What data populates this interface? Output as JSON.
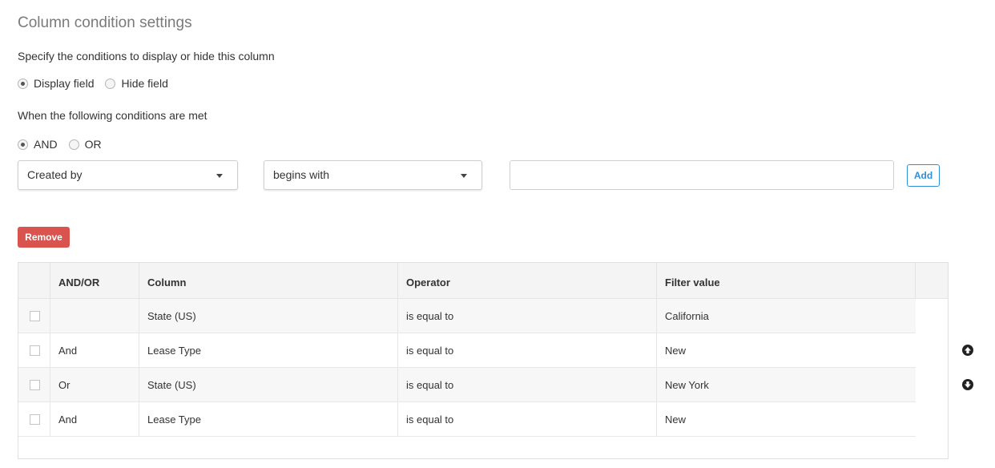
{
  "page": {
    "title": "Column condition settings",
    "description": "Specify the conditions to display or hide this column",
    "visibility_options": [
      {
        "label": "Display field",
        "checked": true
      },
      {
        "label": "Hide field",
        "checked": false
      }
    ],
    "conditions_label": "When the following conditions are met",
    "logic_options": [
      {
        "label": "AND",
        "checked": true
      },
      {
        "label": "OR",
        "checked": false
      }
    ]
  },
  "builder": {
    "column_select": "Created by",
    "operator_select": "begins with",
    "value_input": "",
    "add_label": "Add"
  },
  "actions": {
    "remove_label": "Remove"
  },
  "table": {
    "headers": [
      "AND/OR",
      "Column",
      "Operator",
      "Filter value"
    ],
    "rows": [
      {
        "andor": "",
        "column": "State (US)",
        "operator": "is equal to",
        "value": "California"
      },
      {
        "andor": "And",
        "column": "Lease Type",
        "operator": "is equal to",
        "value": "New"
      },
      {
        "andor": "Or",
        "column": "State (US)",
        "operator": "is equal to",
        "value": "New York"
      },
      {
        "andor": "And",
        "column": "Lease Type",
        "operator": "is equal to",
        "value": "New"
      }
    ]
  },
  "icons": {
    "move_up": "arrow-circle-up-icon",
    "move_down": "arrow-circle-down-icon"
  },
  "colors": {
    "remove": "#d9534f",
    "add": "#2f8fd8",
    "header_bg": "#f4f4f4"
  }
}
